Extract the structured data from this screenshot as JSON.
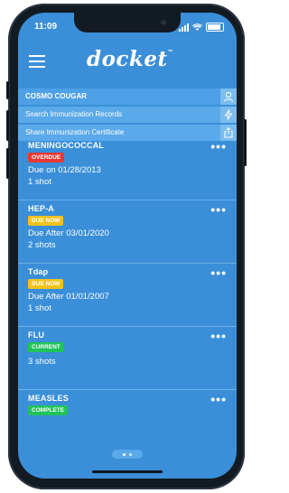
{
  "status_bar": {
    "time": "11:09"
  },
  "header": {
    "logo": "docket",
    "trademark": "™"
  },
  "user_bar": {
    "name": "COSMO COUGAR"
  },
  "actions": {
    "search": "Search Immunization Records",
    "share": "Share Immunization Certificate"
  },
  "vaccines": [
    {
      "name": "MENINGOCOCCAL",
      "status": "OVERDUE",
      "due": "Due on 01/28/2013",
      "shots": "1 shot"
    },
    {
      "name": "HEP-A",
      "status": "DUE NOW",
      "due": "Due After 03/01/2020",
      "shots": "2 shots"
    },
    {
      "name": "Tdap",
      "status": "DUE NOW",
      "due": "Due After 01/01/2007",
      "shots": "1 shot"
    },
    {
      "name": "FLU",
      "status": "CURRENT",
      "due": "",
      "shots": "3 shots"
    },
    {
      "name": "MEASLES",
      "status": "COMPLETE",
      "due": "",
      "shots": ""
    }
  ],
  "more_label": "•••",
  "colors": {
    "background": "#3a8fd8",
    "overdue": "#e53935",
    "due_now": "#f2c21d",
    "current": "#20c35a"
  }
}
